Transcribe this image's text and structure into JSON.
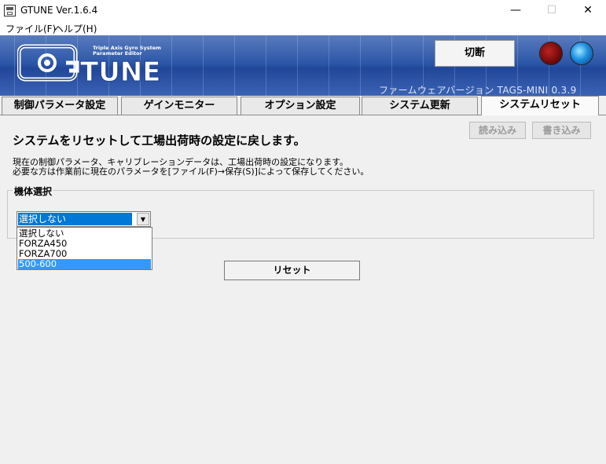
{
  "window": {
    "title": "GTUNE Ver.1.6.4",
    "minimize": "—",
    "maximize": "☐",
    "close": "✕"
  },
  "menu": [
    "ファイル(F)",
    "ヘルプ(H)"
  ],
  "banner": {
    "logo_text": "TUNE",
    "logo_tagline_1": "Triple Axis Gyro System",
    "logo_tagline_2": "Parameter Editor",
    "disconnect_label": "切断",
    "firmware_version": "ファームウェアバージョン  TAGS-MINI  0.3.9",
    "led_red_color": "#7a0c0c",
    "led_blue_color": "#1d8fe0"
  },
  "tabs": [
    {
      "label": "制御パラメータ設定",
      "active": false
    },
    {
      "label": "ゲインモニター",
      "active": false
    },
    {
      "label": "オプション設定",
      "active": false
    },
    {
      "label": "システム更新",
      "active": false
    },
    {
      "label": "システムリセット",
      "active": true
    }
  ],
  "toolbar": {
    "read_label": "読み込み",
    "write_label": "書き込み"
  },
  "content": {
    "heading": "システムをリセットして工場出荷時の設定に戻します。",
    "desc_line_1": "現在の制御パラメータ、キャリブレーションデータは、工場出荷時の設定になります。",
    "desc_line_2": "必要な方は作業前に現在のパラメータを[ファイル(F)→保存(S)]によって保存してください。",
    "group_label": "機体選択",
    "combo_value": "選択しない",
    "dropdown_options": [
      "選択しない",
      "FORZA450",
      "FORZA700",
      "500-600"
    ],
    "dropdown_highlighted": "500-600",
    "reset_label": "リセット"
  }
}
